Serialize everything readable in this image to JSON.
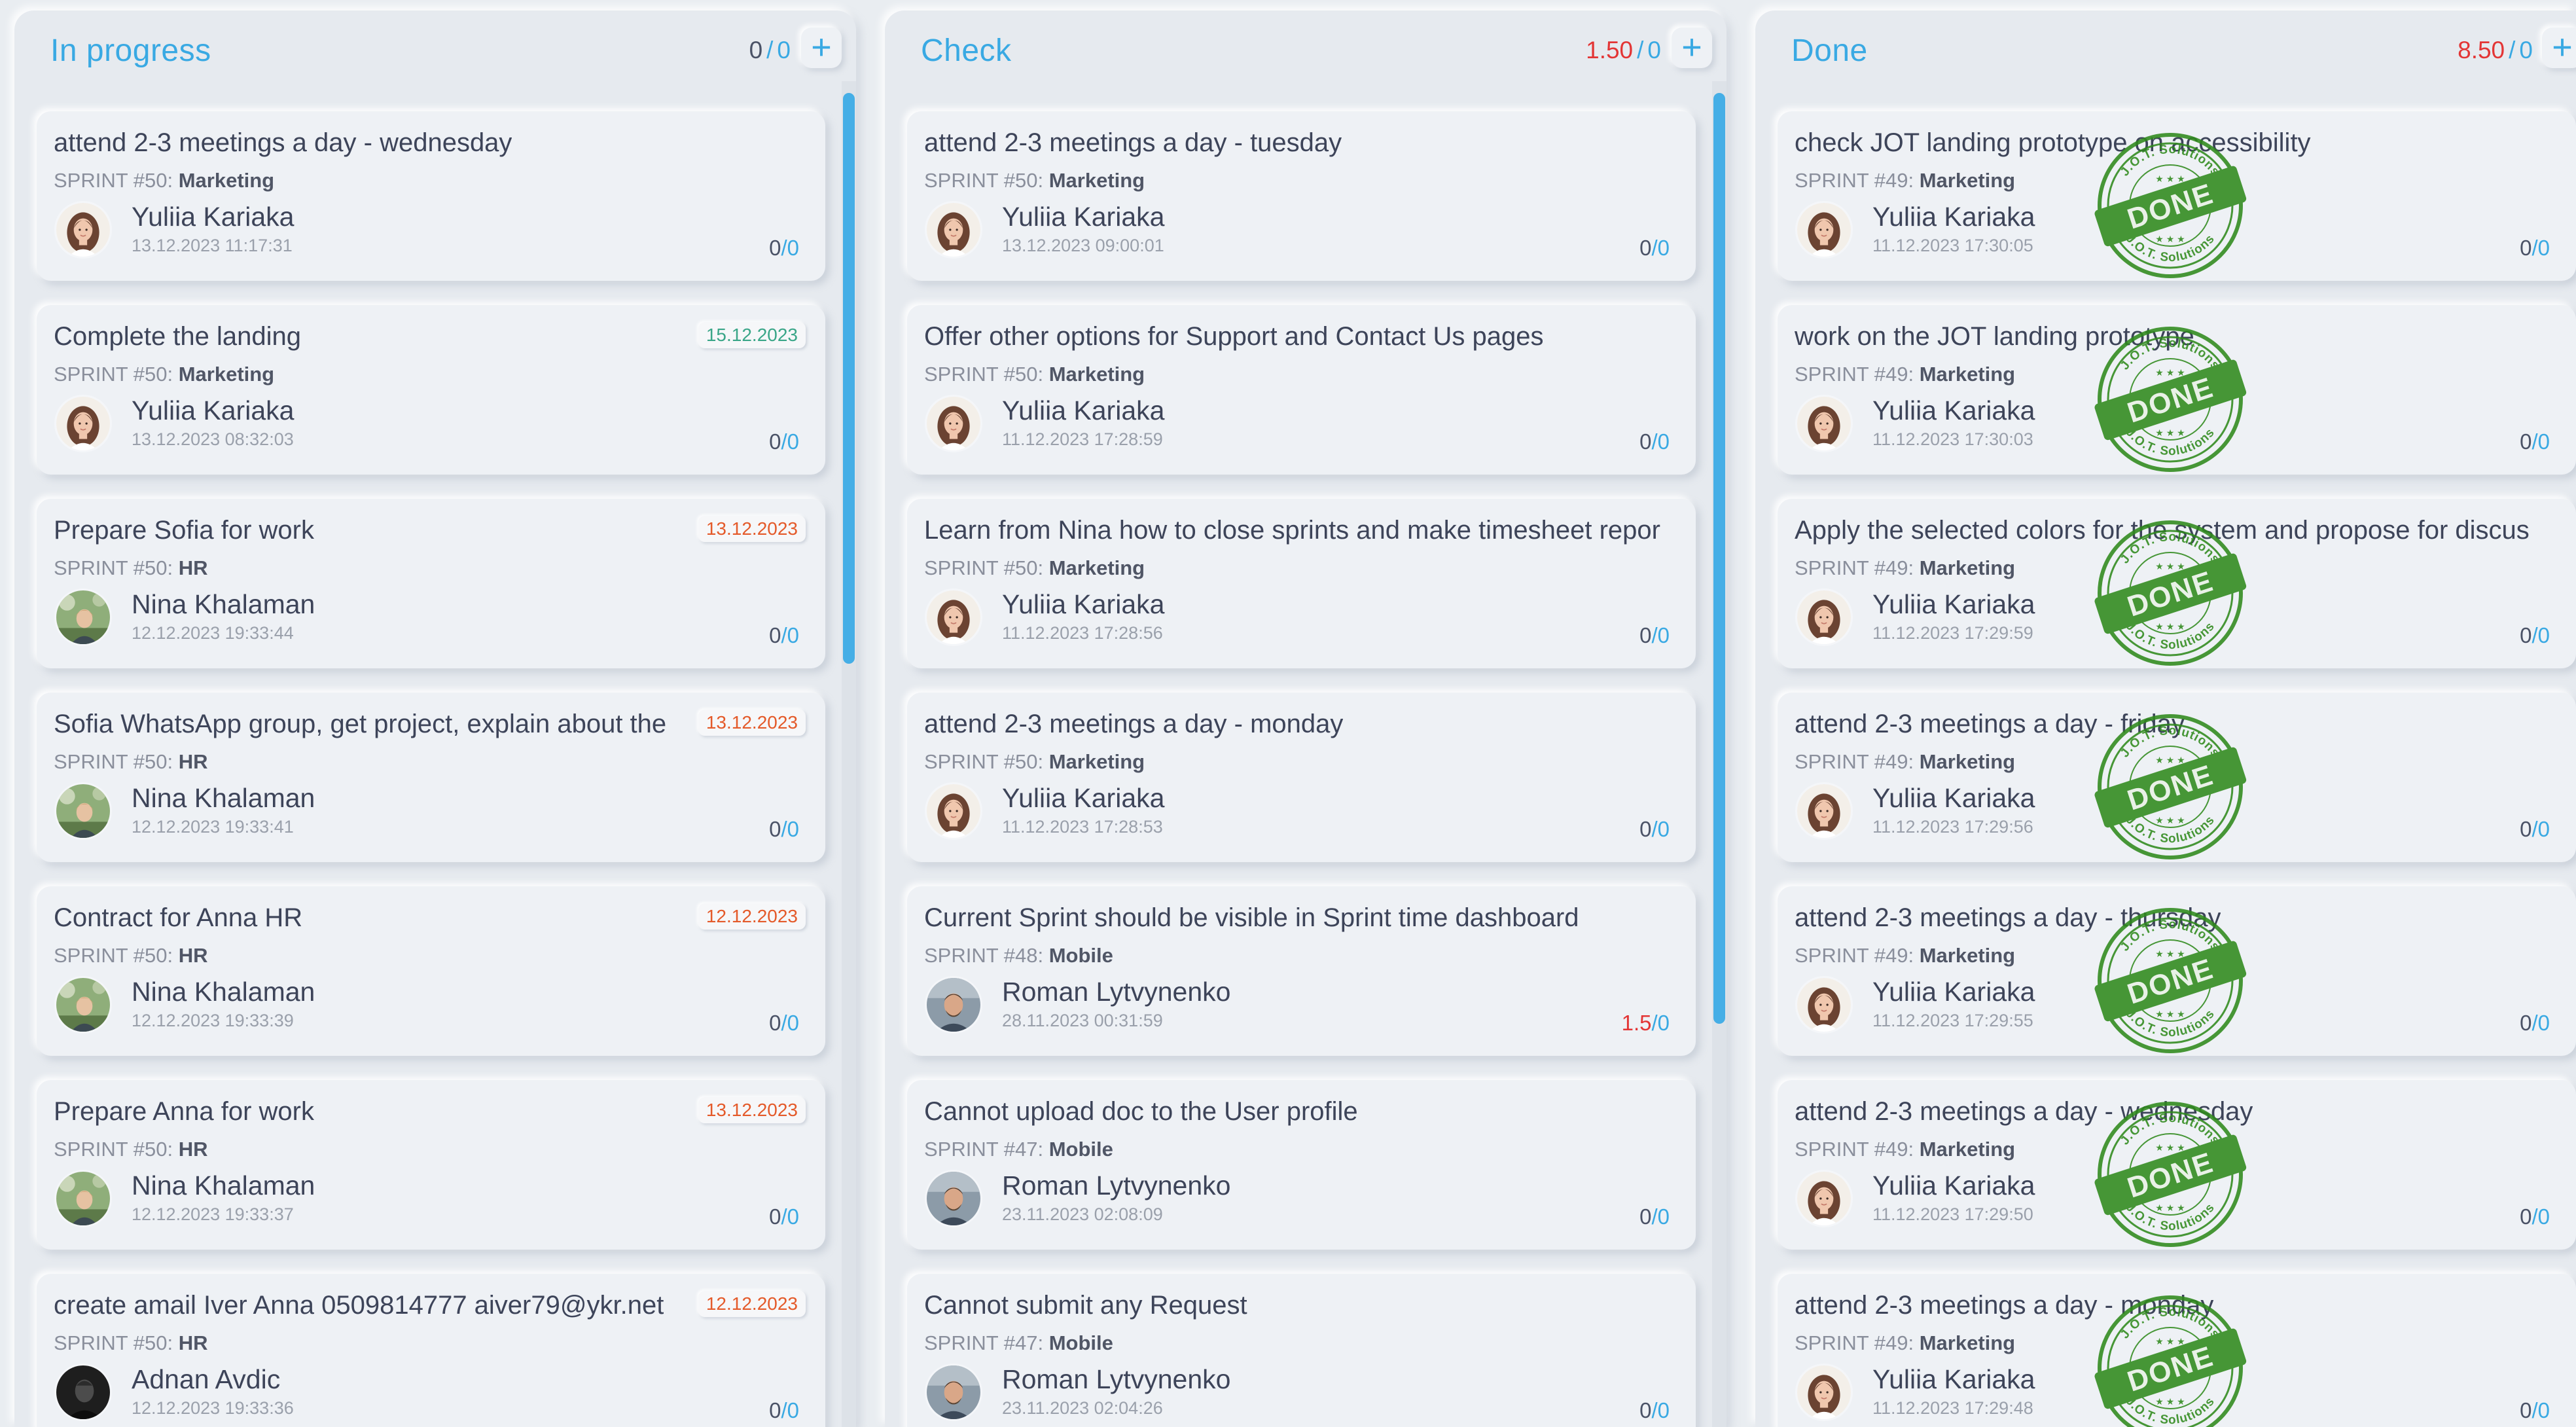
{
  "columns": [
    {
      "title": "In progress",
      "counter": {
        "left": "0",
        "right": "0",
        "left_red": false
      },
      "cards": [
        {
          "title": "attend 2-3 meetings a day - wednesday",
          "sprint_label": "SPRINT #50:",
          "sprint_team": "Marketing",
          "assignee": "Yuliia Kariaka",
          "avatar": "woman",
          "timestamp": "13.12.2023 11:17:31",
          "badge": null,
          "counter": {
            "left": "0",
            "right": "0"
          }
        },
        {
          "title": "Complete the landing",
          "sprint_label": "SPRINT #50:",
          "sprint_team": "Marketing",
          "assignee": "Yuliia Kariaka",
          "avatar": "woman",
          "timestamp": "13.12.2023 08:32:03",
          "badge": {
            "text": "15.12.2023",
            "status": "ok"
          },
          "counter": {
            "left": "0",
            "right": "0"
          }
        },
        {
          "title": "Prepare Sofia for work",
          "sprint_label": "SPRINT #50:",
          "sprint_team": "HR",
          "assignee": "Nina Khalaman",
          "avatar": "outdoor",
          "timestamp": "12.12.2023 19:33:44",
          "badge": {
            "text": "13.12.2023",
            "status": "overdue"
          },
          "counter": {
            "left": "0",
            "right": "0"
          }
        },
        {
          "title": "Sofia WhatsApp group, get project, explain about the",
          "sprint_label": "SPRINT #50:",
          "sprint_team": "HR",
          "assignee": "Nina Khalaman",
          "avatar": "outdoor",
          "timestamp": "12.12.2023 19:33:41",
          "badge": {
            "text": "13.12.2023",
            "status": "overdue"
          },
          "counter": {
            "left": "0",
            "right": "0"
          }
        },
        {
          "title": "Contract for Anna HR",
          "sprint_label": "SPRINT #50:",
          "sprint_team": "HR",
          "assignee": "Nina Khalaman",
          "avatar": "outdoor",
          "timestamp": "12.12.2023 19:33:39",
          "badge": {
            "text": "12.12.2023",
            "status": "overdue"
          },
          "counter": {
            "left": "0",
            "right": "0"
          }
        },
        {
          "title": "Prepare Anna for work",
          "sprint_label": "SPRINT #50:",
          "sprint_team": "HR",
          "assignee": "Nina Khalaman",
          "avatar": "outdoor",
          "timestamp": "12.12.2023 19:33:37",
          "badge": {
            "text": "13.12.2023",
            "status": "overdue"
          },
          "counter": {
            "left": "0",
            "right": "0"
          }
        },
        {
          "title": "create amail Iver Anna 0509814777 aiver79@ykr.net",
          "sprint_label": "SPRINT #50:",
          "sprint_team": "HR",
          "assignee": "Adnan Avdic",
          "avatar": "dark",
          "timestamp": "12.12.2023 19:33:36",
          "badge": {
            "text": "12.12.2023",
            "status": "overdue"
          },
          "counter": {
            "left": "0",
            "right": "0"
          }
        }
      ]
    },
    {
      "title": "Check",
      "counter": {
        "left": "1.50",
        "right": "0",
        "left_red": true
      },
      "cards": [
        {
          "title": "attend 2-3 meetings a day - tuesday",
          "sprint_label": "SPRINT #50:",
          "sprint_team": "Marketing",
          "assignee": "Yuliia Kariaka",
          "avatar": "woman",
          "timestamp": "13.12.2023 09:00:01",
          "badge": null,
          "counter": {
            "left": "0",
            "right": "0"
          }
        },
        {
          "title": "Offer other options for Support and Contact Us pages",
          "sprint_label": "SPRINT #50:",
          "sprint_team": "Marketing",
          "assignee": "Yuliia Kariaka",
          "avatar": "woman",
          "timestamp": "11.12.2023 17:28:59",
          "badge": null,
          "counter": {
            "left": "0",
            "right": "0"
          }
        },
        {
          "title": "Learn from Nina how to close sprints and make timesheet repor",
          "sprint_label": "SPRINT #50:",
          "sprint_team": "Marketing",
          "assignee": "Yuliia Kariaka",
          "avatar": "woman",
          "timestamp": "11.12.2023 17:28:56",
          "badge": null,
          "counter": {
            "left": "0",
            "right": "0"
          }
        },
        {
          "title": "attend 2-3 meetings a day - monday",
          "sprint_label": "SPRINT #50:",
          "sprint_team": "Marketing",
          "assignee": "Yuliia Kariaka",
          "avatar": "woman",
          "timestamp": "11.12.2023 17:28:53",
          "badge": null,
          "counter": {
            "left": "0",
            "right": "0"
          }
        },
        {
          "title": "Current Sprint should be visible in Sprint time dashboard",
          "sprint_label": "SPRINT #48:",
          "sprint_team": "Mobile",
          "assignee": "Roman Lytvynenko",
          "avatar": "man",
          "timestamp": "28.11.2023 00:31:59",
          "badge": null,
          "counter": {
            "left": "1.5",
            "right": "0",
            "left_red": true
          }
        },
        {
          "title": "Cannot upload doc to the User profile",
          "sprint_label": "SPRINT #47:",
          "sprint_team": "Mobile",
          "assignee": "Roman Lytvynenko",
          "avatar": "man",
          "timestamp": "23.11.2023 02:08:09",
          "badge": null,
          "counter": {
            "left": "0",
            "right": "0"
          }
        },
        {
          "title": "Cannot submit any Request",
          "sprint_label": "SPRINT #47:",
          "sprint_team": "Mobile",
          "assignee": "Roman Lytvynenko",
          "avatar": "man",
          "timestamp": "23.11.2023 02:04:26",
          "badge": null,
          "counter": {
            "left": "0",
            "right": "0"
          }
        }
      ]
    },
    {
      "title": "Done",
      "counter": {
        "left": "8.50",
        "right": "0",
        "left_red": true
      },
      "cards": [
        {
          "title": "check JOT landing prototype on accessibility",
          "sprint_label": "SPRINT #49:",
          "sprint_team": "Marketing",
          "assignee": "Yuliia Kariaka",
          "avatar": "woman",
          "timestamp": "11.12.2023 17:30:05",
          "badge": null,
          "stamp": true,
          "counter": {
            "left": "0",
            "right": "0"
          }
        },
        {
          "title": "work on the JOT landing prototype",
          "sprint_label": "SPRINT #49:",
          "sprint_team": "Marketing",
          "assignee": "Yuliia Kariaka",
          "avatar": "woman",
          "timestamp": "11.12.2023 17:30:03",
          "badge": null,
          "stamp": true,
          "counter": {
            "left": "0",
            "right": "0"
          }
        },
        {
          "title": "Apply the selected colors for the system and propose for discus",
          "sprint_label": "SPRINT #49:",
          "sprint_team": "Marketing",
          "assignee": "Yuliia Kariaka",
          "avatar": "woman",
          "timestamp": "11.12.2023 17:29:59",
          "badge": null,
          "stamp": true,
          "counter": {
            "left": "0",
            "right": "0"
          }
        },
        {
          "title": "attend 2-3 meetings a day - friday",
          "sprint_label": "SPRINT #49:",
          "sprint_team": "Marketing",
          "assignee": "Yuliia Kariaka",
          "avatar": "woman",
          "timestamp": "11.12.2023 17:29:56",
          "badge": null,
          "stamp": true,
          "counter": {
            "left": "0",
            "right": "0"
          }
        },
        {
          "title": "attend 2-3 meetings a day - thursday",
          "sprint_label": "SPRINT #49:",
          "sprint_team": "Marketing",
          "assignee": "Yuliia Kariaka",
          "avatar": "woman",
          "timestamp": "11.12.2023 17:29:55",
          "badge": null,
          "stamp": true,
          "counter": {
            "left": "0",
            "right": "0"
          }
        },
        {
          "title": "attend 2-3 meetings a day - wednesday",
          "sprint_label": "SPRINT #49:",
          "sprint_team": "Marketing",
          "assignee": "Yuliia Kariaka",
          "avatar": "woman",
          "timestamp": "11.12.2023 17:29:50",
          "badge": null,
          "stamp": true,
          "counter": {
            "left": "0",
            "right": "0"
          }
        },
        {
          "title": "attend 2-3 meetings a day - monday",
          "sprint_label": "SPRINT #49:",
          "sprint_team": "Marketing",
          "assignee": "Yuliia Kariaka",
          "avatar": "woman",
          "timestamp": "11.12.2023 17:29:48",
          "badge": null,
          "stamp": true,
          "counter": {
            "left": "0",
            "right": "0"
          }
        }
      ]
    }
  ],
  "stamp": {
    "main": "DONE",
    "ring_top": "J.O.T. Solutions",
    "ring_bottom": "J.O.T. Solutions"
  },
  "colors": {
    "accent": "#39a9e3",
    "overdue": "#e45a2a",
    "on_time": "#3aa688",
    "stamp_green": "#2f8a1c",
    "negative_count": "#e33535"
  }
}
